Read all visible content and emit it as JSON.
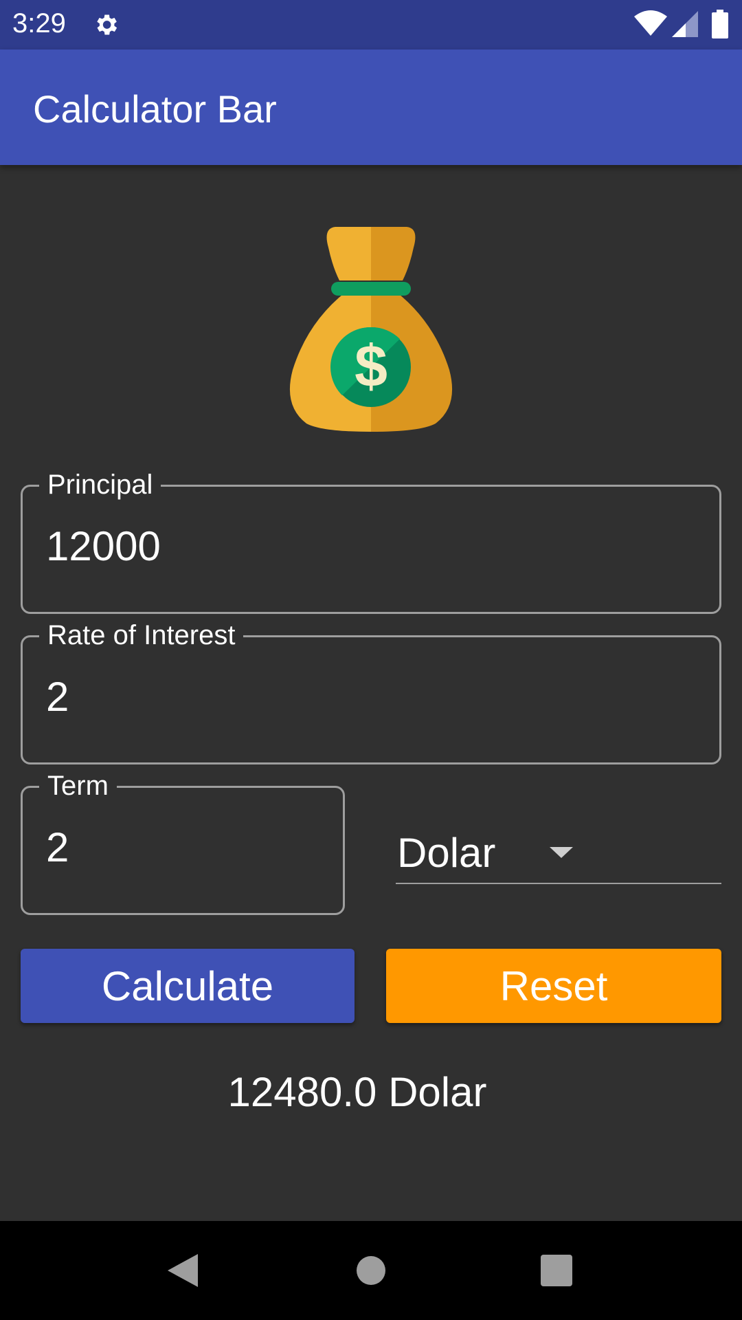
{
  "status_bar": {
    "time": "3:29",
    "icons": [
      "gear-icon",
      "wifi-icon",
      "cell-signal-icon",
      "battery-icon"
    ]
  },
  "app_bar": {
    "title": "Calculator Bar"
  },
  "image": {
    "icon": "money-bag-icon",
    "symbol": "$"
  },
  "principal": {
    "label": "Principal",
    "value": "12000"
  },
  "rate": {
    "label": "Rate of Interest",
    "value": "2"
  },
  "term": {
    "label": "Term",
    "value": "2"
  },
  "currency": {
    "selected": "Dolar"
  },
  "buttons": {
    "calculate": "Calculate",
    "reset": "Reset"
  },
  "result": {
    "text": "12480.0 Dolar"
  },
  "nav": {
    "icons": [
      "back-icon",
      "home-icon",
      "recents-icon"
    ]
  },
  "colors": {
    "status_bar": "#2f3c8d",
    "app_bar": "#3f51b5",
    "background": "#303030",
    "calculate_button": "#3f51b5",
    "reset_button": "#ff9800",
    "nav_bar": "#000000"
  }
}
